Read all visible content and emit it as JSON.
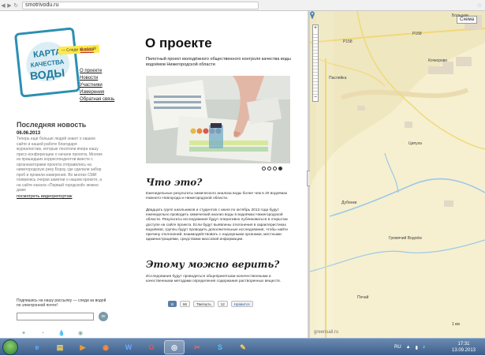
{
  "browser": {
    "url": "smotrivodu.ru"
  },
  "site": {
    "logo": {
      "line1": "КАРТА",
      "line2": "КАЧЕСТВА",
      "line3": "ВОДЫ",
      "tag": "— Следи за водой!"
    },
    "login": "Войти",
    "menu": [
      "О проекте",
      "Новости",
      "Участники",
      "Измерения",
      "Обратная связь"
    ],
    "news": {
      "heading": "Последняя новость",
      "date": "06.06.2013",
      "text": "Теперь ещё больше людей знают о нашем сайте и нашей работе благодаря журналистам, которые посетили вчера нашу пресс-конференцию о начале проекта. Многие из пришедших корреспондентов вместе с организаторами проекта отправились на нижегородскую реку Борзу, где сделали забор проб и провели измерения. Во многих СМИ появились очерки заметки о нашем проекте, а на сайте канала «Первый городской» можно даже",
      "link": "посмотреть видеорепортаж"
    },
    "subscribe": {
      "label": "Подпишись на нашу рассылку — следи за водой по электронной почте!",
      "button": "ок"
    }
  },
  "main": {
    "title": "О проекте",
    "lead": "Пилотный проект молодёжного общественного контроля качества воды водоёмов Нижегородской области",
    "slides": 4,
    "active_slide": 4,
    "section1_title": "Что это?",
    "section1_p1": "Еженедельные результаты химического анализа воды более чем в 20 водоёмах Нижнего Новгорода и Нижегородской области.",
    "section1_p2": "Двадцать групп школьников и студентов с июня по октябрь 2013 года будут еженедельно проводить химический анализ воды в водоёмах Нижегородской области. Результаты исследования будут оперативно публиковаться в открытом доступе на сайте проекта. Если будут выявлены отклонения в характеристиках водоёмов, группы будут проводить дополнительные исследования, чтобы найти причину отклонений, взаимодействовать с надзорными органами, местными администрациями, средствами массовой информации.",
    "section2_title": "Этому можно верить?",
    "section2_p1": "Исследования будут проводиться общепринятыми количественными и качественными методами определения содержания растворенных веществ.",
    "social": {
      "vk": "В",
      "vk_count": "66",
      "tweet": "Твитнуть",
      "tweet_count": "12",
      "fb": "Нравится"
    }
  },
  "map": {
    "scheme_button": "Схема",
    "labels": [
      "Большое",
      "Р158",
      "Р158",
      "Кочкорово",
      "Пасляйка",
      "Ципуха",
      "Дубинки",
      "Гремячий Водоём",
      "Почай"
    ],
    "footer": "greensail.ru",
    "scale": "1 км"
  },
  "taskbar": {
    "lang": "RU",
    "time": "17:31",
    "date": "13.09.2013",
    "icons": [
      "ie-icon",
      "explorer-icon",
      "media-icon",
      "firefox-icon",
      "word-icon",
      "opera-icon",
      "chrome-icon",
      "tool-icon",
      "skype-icon",
      "paint-icon"
    ]
  },
  "colors": {
    "accent": "#2b8fb2",
    "login": "#c0282d",
    "map_bg": "#f6f0d0",
    "road": "#f0d878",
    "water": "#9cc8e6"
  }
}
